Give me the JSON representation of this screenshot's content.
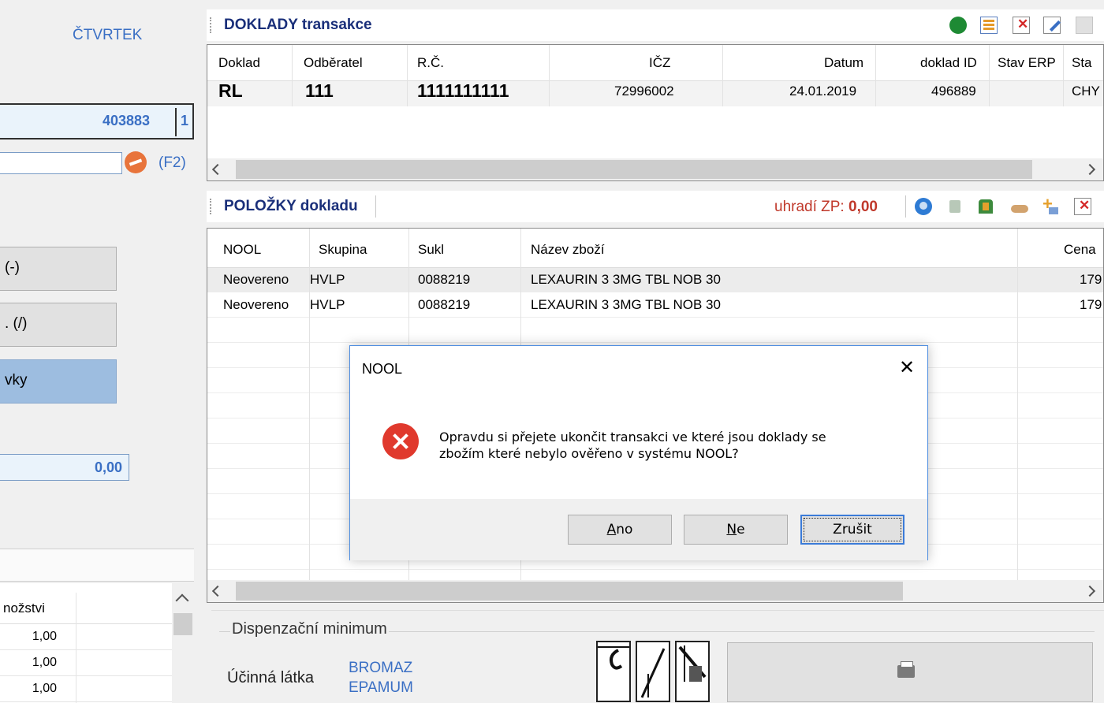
{
  "left_panel": {
    "day": "ČTVRTEK",
    "box_number": "403883",
    "box_suffix": "1",
    "shortcut": "(F2)",
    "btn1": "(-)",
    "btn2": ". (/)",
    "btn3": "vky",
    "total": "0,00",
    "grid_header": "nožstvi",
    "grid_rows": [
      "1,00",
      "1,00",
      "1,00"
    ]
  },
  "doklady": {
    "title_bold": "DOKLADY",
    "title_rest": " transakce",
    "columns": [
      "Doklad",
      "Odběratel",
      "R.Č.",
      "IČZ",
      "Datum",
      "doklad ID",
      "Stav ERP",
      "Sta"
    ],
    "row": {
      "doklad": "RL",
      "odberatel": "111",
      "rc": "1111111111",
      "icz": "72996002",
      "datum": "24.01.2019",
      "doklad_id": "496889",
      "stav_erp": "",
      "stav": "CHY"
    }
  },
  "polozky": {
    "title": "POLOŽKY dokladu",
    "uhradi_label": "uhradí ZP:",
    "uhradi_value": "0,00",
    "columns": [
      "NOOL",
      "Skupina",
      "Sukl",
      "Název zboží",
      "Cena"
    ],
    "rows": [
      {
        "nool": "Neovereno",
        "skupina": "HVLP",
        "sukl": "0088219",
        "nazev": "LEXAURIN 3 3MG TBL NOB 30",
        "cena": "179"
      },
      {
        "nool": "Neovereno",
        "skupina": "HVLP",
        "sukl": "0088219",
        "nazev": "LEXAURIN 3 3MG TBL NOB 30",
        "cena": "179"
      }
    ]
  },
  "dispenzacni": {
    "title": "Dispenzační minimum",
    "ucinna_label": "Účinná látka",
    "ucinna_line1": "BROMAZ",
    "ucinna_line2": "EPAMUM"
  },
  "dialog": {
    "title": "NOOL",
    "close": "✕",
    "message_line1": "Opravdu si přejete ukončit transakci ve které jsou doklady se",
    "message_line2": "zbožím které nebylo ověřeno v systému NOOL?",
    "btn_ano_u": "A",
    "btn_ano_rest": "no",
    "btn_ne_u": "N",
    "btn_ne_rest": "e",
    "btn_zrusit": "Zrušit"
  }
}
